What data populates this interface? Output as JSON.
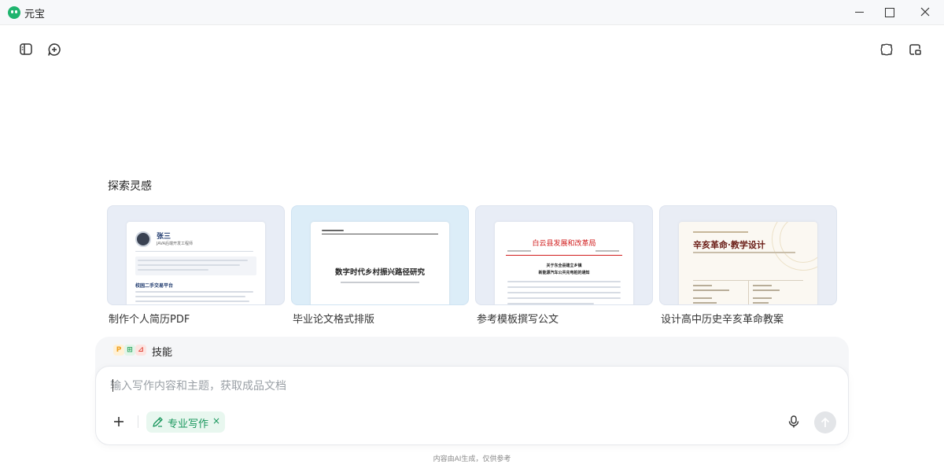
{
  "window": {
    "title": "元宝",
    "controls": [
      "minimize-icon",
      "maximize-icon",
      "close-icon"
    ]
  },
  "toolbar": {
    "left_icons": [
      "sidebar-toggle-icon",
      "new-chat-icon"
    ],
    "right_icons": [
      "screenshot-icon",
      "float-window-icon"
    ]
  },
  "explore": {
    "title": "探索灵感",
    "cards": [
      {
        "label": "制作个人简历PDF",
        "preview": {
          "name": "张三",
          "role": "JAVA后端开发工程师",
          "section": "校园二手交易平台"
        }
      },
      {
        "label": "毕业论文格式排版",
        "preview": {
          "title": "数字时代乡村振兴路径研究"
        }
      },
      {
        "label": "参考模板撰写公文",
        "preview": {
          "org": "白云县发展和改革局",
          "heading1": "关于东全县建立乡镇",
          "heading2": "新能源汽车公共充电桩的通知"
        }
      },
      {
        "label": "设计高中历史辛亥革命教案",
        "preview": {
          "title": "辛亥革命·教学设计"
        }
      }
    ]
  },
  "composer": {
    "skills_label": "技能",
    "skill_icons": [
      {
        "glyph": "P",
        "color": "#f0a020"
      },
      {
        "glyph": "⊞",
        "color": "#27a35a"
      },
      {
        "glyph": "⊿",
        "color": "#e0463a"
      }
    ],
    "placeholder": "输入写作内容和主题，获取成品文档",
    "chip_label": "专业写作",
    "chip_close": "×",
    "add_icon": "plus-icon",
    "mic_icon": "microphone-icon",
    "send_icon": "send-arrow-icon"
  },
  "footer": {
    "note": "内容由AI生成，仅供参考"
  },
  "colors": {
    "accent_green": "#17965b",
    "chip_bg": "#e8f7ef",
    "send_disabled": "#e3e5e8"
  }
}
